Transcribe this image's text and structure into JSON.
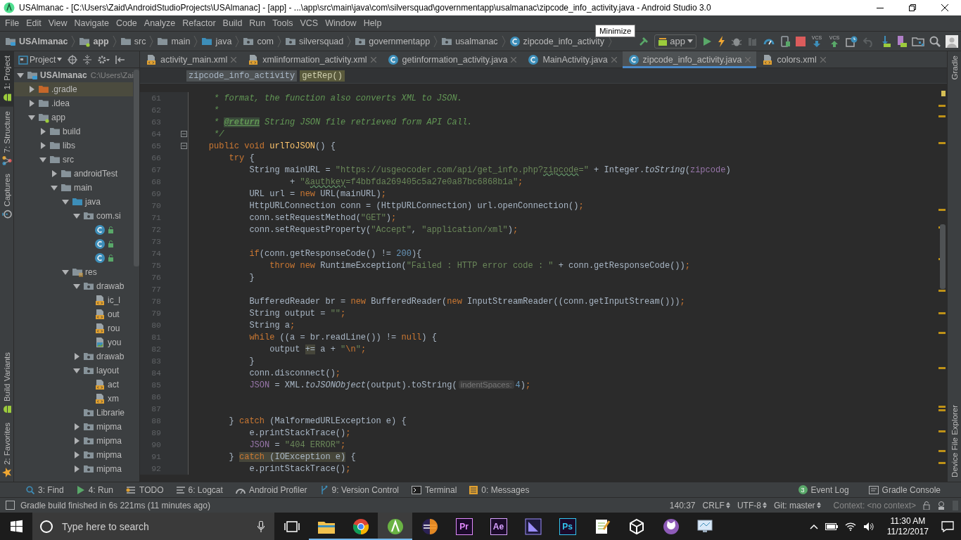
{
  "window": {
    "title": "USAlmanac - [C:\\Users\\Zaid\\AndroidStudioProjects\\USAlmanac] - [app] - ...\\app\\src\\main\\java\\com\\silversquad\\governmentapp\\usalmanac\\zipcode_info_activity.java - Android Studio 3.0"
  },
  "menu": [
    "File",
    "Edit",
    "View",
    "Navigate",
    "Code",
    "Analyze",
    "Refactor",
    "Build",
    "Run",
    "Tools",
    "VCS",
    "Window",
    "Help"
  ],
  "navigation": {
    "breadcrumbs": [
      {
        "label": "USAlmanac",
        "kind": "project"
      },
      {
        "label": "app",
        "kind": "module"
      },
      {
        "label": "src",
        "kind": "folder"
      },
      {
        "label": "main",
        "kind": "folder"
      },
      {
        "label": "java",
        "kind": "source"
      },
      {
        "label": "com",
        "kind": "package"
      },
      {
        "label": "silversquad",
        "kind": "package"
      },
      {
        "label": "governmentapp",
        "kind": "package"
      },
      {
        "label": "usalmanac",
        "kind": "package"
      },
      {
        "label": "zipcode_info_activity",
        "kind": "class"
      }
    ],
    "run_configuration": "app",
    "vcs_update": "VCS",
    "vcs_commit": "VCS",
    "tooltip": "Minimize"
  },
  "left_tool_strip": {
    "top": [
      {
        "label": "1: Project",
        "kind": "android",
        "selected": true
      },
      {
        "label": "7: Structure",
        "kind": "structure",
        "selected": false
      },
      {
        "label": "Captures",
        "kind": "captures",
        "selected": false
      }
    ],
    "bottom": [
      {
        "label": "Build Variants",
        "kind": "android",
        "selected": false
      },
      {
        "label": "2: Favorites",
        "kind": "star",
        "selected": false
      }
    ]
  },
  "right_tool_strip": {
    "top": [
      {
        "label": "Gradle",
        "selected": false
      }
    ],
    "bottom": [
      {
        "label": "Device File Explorer",
        "selected": false
      }
    ]
  },
  "project_panel": {
    "title": "Project",
    "tree": [
      {
        "label": "USAlmanac",
        "path": "C:\\Users\\Zai",
        "kind": "project",
        "expanded": true,
        "selected": false,
        "children": [
          {
            "label": ".gradle",
            "kind": "excluded",
            "expanded": false,
            "selected": true
          },
          {
            "label": ".idea",
            "kind": "folder",
            "expanded": false,
            "selected": false
          },
          {
            "label": "app",
            "kind": "module",
            "expanded": true,
            "selected": false,
            "children": [
              {
                "label": "build",
                "kind": "folder",
                "expanded": false,
                "selected": false
              },
              {
                "label": "libs",
                "kind": "folder",
                "expanded": false,
                "selected": false
              },
              {
                "label": "src",
                "kind": "folder",
                "expanded": true,
                "selected": false,
                "children": [
                  {
                    "label": "androidTest",
                    "kind": "folder",
                    "expanded": false,
                    "selected": false
                  },
                  {
                    "label": "main",
                    "kind": "folder",
                    "expanded": true,
                    "selected": false,
                    "children": [
                      {
                        "label": "java",
                        "kind": "source",
                        "expanded": true,
                        "selected": false,
                        "children": [
                          {
                            "label": "com.si",
                            "kind": "package",
                            "expanded": true,
                            "selected": false,
                            "children": [
                              {
                                "kind": "class",
                                "selected": false
                              },
                              {
                                "kind": "class",
                                "selected": false
                              },
                              {
                                "kind": "class",
                                "selected": false
                              }
                            ]
                          }
                        ]
                      },
                      {
                        "label": "res",
                        "kind": "resources",
                        "expanded": true,
                        "selected": false,
                        "children": [
                          {
                            "label": "drawab",
                            "kind": "package",
                            "expanded": true,
                            "selected": false,
                            "children": [
                              {
                                "label": "ic_l",
                                "kind": "xml",
                                "selected": false
                              },
                              {
                                "label": "out",
                                "kind": "xml",
                                "selected": false
                              },
                              {
                                "label": "rou",
                                "kind": "xml",
                                "selected": false
                              },
                              {
                                "label": "you",
                                "kind": "image",
                                "selected": false
                              }
                            ]
                          },
                          {
                            "label": "drawab",
                            "kind": "package",
                            "expanded": false,
                            "selected": false
                          },
                          {
                            "label": "layout",
                            "kind": "package",
                            "expanded": true,
                            "selected": false,
                            "children": [
                              {
                                "label": "act",
                                "kind": "xml",
                                "selected": false
                              },
                              {
                                "label": "xm",
                                "kind": "xml",
                                "selected": false
                              }
                            ]
                          },
                          {
                            "label": "Librarie",
                            "kind": "package",
                            "selected": false
                          },
                          {
                            "label": "mipma",
                            "kind": "package",
                            "expanded": false,
                            "selected": false
                          },
                          {
                            "label": "mipma",
                            "kind": "package",
                            "expanded": false,
                            "selected": false
                          },
                          {
                            "label": "mipma",
                            "kind": "package",
                            "expanded": false,
                            "selected": false
                          },
                          {
                            "label": "mipma",
                            "kind": "package",
                            "expanded": false,
                            "selected": false
                          }
                        ]
                      }
                    ]
                  }
                ]
              }
            ]
          }
        ]
      }
    ]
  },
  "editor": {
    "tabs": [
      {
        "label": "activity_main.xml",
        "kind": "xml",
        "selected": false
      },
      {
        "label": "xmlinformation_activity.xml",
        "kind": "xml",
        "selected": false
      },
      {
        "label": "getinformation_activity.java",
        "kind": "class",
        "selected": false
      },
      {
        "label": "MainActivity.java",
        "kind": "class",
        "selected": false
      },
      {
        "label": "zipcode_info_activity.java",
        "kind": "class",
        "selected": true
      },
      {
        "label": "colors.xml",
        "kind": "xml",
        "selected": false
      }
    ],
    "breadcrumbs": [
      "zipcode_info_activity",
      "getRep()"
    ],
    "lines": [
      {
        "number": "61",
        "tokens": [
          {
            "kind": "cmt",
            "text": "     * format, the function also converts XML to JSON."
          }
        ]
      },
      {
        "number": "62",
        "tokens": [
          {
            "kind": "cmt",
            "text": "     *"
          }
        ]
      },
      {
        "number": "63",
        "tokens": [
          {
            "kind": "cmt",
            "text": "     * "
          },
          {
            "kind": "tag",
            "text": "@return"
          },
          {
            "kind": "cmt",
            "text": " String JSON file retrieved form API Call."
          }
        ]
      },
      {
        "number": "64",
        "fold": true,
        "tokens": [
          {
            "kind": "cmt",
            "text": "     */"
          }
        ]
      },
      {
        "number": "65",
        "fold": true,
        "tokens": [
          {
            "kind": "kw",
            "text": "    public void "
          },
          {
            "kind": "decl",
            "text": "urlToJSON"
          },
          {
            "kind": "plain",
            "text": "() {"
          }
        ]
      },
      {
        "number": "66",
        "tokens": [
          {
            "kind": "kw",
            "text": "        try"
          },
          {
            "kind": "plain",
            "text": " {"
          }
        ]
      },
      {
        "number": "67",
        "tokens": [
          {
            "kind": "plain",
            "text": "            String mainURL = "
          },
          {
            "kind": "str",
            "text": "\"https://usgeocoder.com/api/get_info.php?"
          },
          {
            "kind": "typo",
            "text": "zipcode"
          },
          {
            "kind": "str",
            "text": "=\""
          },
          {
            "kind": "plain",
            "text": " + Integer."
          },
          {
            "kind": "static",
            "text": "toString"
          },
          {
            "kind": "plain",
            "text": "("
          },
          {
            "kind": "field",
            "text": "zipcode"
          },
          {
            "kind": "plain",
            "text": ")"
          }
        ]
      },
      {
        "number": "68",
        "tokens": [
          {
            "kind": "plain",
            "text": "                    + "
          },
          {
            "kind": "str",
            "text": "\"&"
          },
          {
            "kind": "typo",
            "text": "authkey"
          },
          {
            "kind": "str",
            "text": "=f4bbfda269405c5a27e0a87bc6868b1a\""
          },
          {
            "kind": "kw",
            "text": ";"
          }
        ]
      },
      {
        "number": "69",
        "tokens": [
          {
            "kind": "plain",
            "text": "            URL url = "
          },
          {
            "kind": "kw",
            "text": "new"
          },
          {
            "kind": "plain",
            "text": " URL(mainURL)"
          },
          {
            "kind": "kw",
            "text": ";"
          }
        ]
      },
      {
        "number": "70",
        "tokens": [
          {
            "kind": "plain",
            "text": "            HttpURLConnection conn = (HttpURLConnection) url.openConnection()"
          },
          {
            "kind": "kw",
            "text": ";"
          }
        ]
      },
      {
        "number": "71",
        "tokens": [
          {
            "kind": "plain",
            "text": "            conn.setRequestMethod("
          },
          {
            "kind": "str",
            "text": "\"GET\""
          },
          {
            "kind": "plain",
            "text": ")"
          },
          {
            "kind": "kw",
            "text": ";"
          }
        ]
      },
      {
        "number": "72",
        "tokens": [
          {
            "kind": "plain",
            "text": "            conn.setRequestProperty("
          },
          {
            "kind": "str",
            "text": "\"Accept\""
          },
          {
            "kind": "plain",
            "text": ", "
          },
          {
            "kind": "str",
            "text": "\"application/xml\""
          },
          {
            "kind": "plain",
            "text": ")"
          },
          {
            "kind": "kw",
            "text": ";"
          }
        ]
      },
      {
        "number": "73"
      },
      {
        "number": "74",
        "tokens": [
          {
            "kind": "kw",
            "text": "            if"
          },
          {
            "kind": "plain",
            "text": "(conn.getResponseCode() != "
          },
          {
            "kind": "num",
            "text": "200"
          },
          {
            "kind": "plain",
            "text": "){"
          }
        ]
      },
      {
        "number": "75",
        "tokens": [
          {
            "kind": "kw",
            "text": "                throw new"
          },
          {
            "kind": "plain",
            "text": " RuntimeException("
          },
          {
            "kind": "str",
            "text": "\"Failed : HTTP error code : \""
          },
          {
            "kind": "plain",
            "text": " + conn.getResponseCode())"
          },
          {
            "kind": "kw",
            "text": ";"
          }
        ]
      },
      {
        "number": "76",
        "tokens": [
          {
            "kind": "plain",
            "text": "            }"
          }
        ]
      },
      {
        "number": "77"
      },
      {
        "number": "78",
        "tokens": [
          {
            "kind": "plain",
            "text": "            BufferedReader br = "
          },
          {
            "kind": "kw",
            "text": "new"
          },
          {
            "kind": "plain",
            "text": " BufferedReader("
          },
          {
            "kind": "kw",
            "text": "new"
          },
          {
            "kind": "plain",
            "text": " InputStreamReader((conn.getInputStream()))"
          },
          {
            "kind": "kw",
            "text": ";"
          }
        ]
      },
      {
        "number": "79",
        "tokens": [
          {
            "kind": "plain",
            "text": "            String output = "
          },
          {
            "kind": "str",
            "text": "\"\""
          },
          {
            "kind": "kw",
            "text": ";"
          }
        ]
      },
      {
        "number": "80",
        "tokens": [
          {
            "kind": "plain",
            "text": "            String a"
          },
          {
            "kind": "kw",
            "text": ";"
          }
        ]
      },
      {
        "number": "81",
        "tokens": [
          {
            "kind": "kw",
            "text": "            while"
          },
          {
            "kind": "plain",
            "text": " ((a = br.readLine()) != "
          },
          {
            "kind": "kw",
            "text": "null"
          },
          {
            "kind": "plain",
            "text": ") {"
          }
        ]
      },
      {
        "number": "82",
        "tokens": [
          {
            "kind": "plain",
            "text": "                output "
          },
          {
            "kind": "match",
            "text": "+="
          },
          {
            "kind": "plain",
            "text": " a + "
          },
          {
            "kind": "str",
            "text": "\""
          },
          {
            "kind": "esc",
            "text": "\\n"
          },
          {
            "kind": "str",
            "text": "\""
          },
          {
            "kind": "kw",
            "text": ";"
          }
        ]
      },
      {
        "number": "83",
        "tokens": [
          {
            "kind": "plain",
            "text": "            }"
          }
        ]
      },
      {
        "number": "84",
        "tokens": [
          {
            "kind": "plain",
            "text": "            conn.disconnect()"
          },
          {
            "kind": "kw",
            "text": ";"
          }
        ]
      },
      {
        "number": "85",
        "tokens": [
          {
            "kind": "field",
            "text": "            JSON"
          },
          {
            "kind": "plain",
            "text": " = XML."
          },
          {
            "kind": "static",
            "text": "toJSONObject"
          },
          {
            "kind": "plain",
            "text": "(output).toString("
          },
          {
            "kind": "hint",
            "text": "indentSpaces:"
          },
          {
            "kind": "num",
            "text": "4"
          },
          {
            "kind": "plain",
            "text": ")"
          },
          {
            "kind": "kw",
            "text": ";"
          }
        ]
      },
      {
        "number": "86"
      },
      {
        "number": "87"
      },
      {
        "number": "88",
        "tokens": [
          {
            "kind": "plain",
            "text": "        } "
          },
          {
            "kind": "kw",
            "text": "catch"
          },
          {
            "kind": "plain",
            "text": " (MalformedURLException e) {"
          }
        ]
      },
      {
        "number": "89",
        "tokens": [
          {
            "kind": "plain",
            "text": "            e.printStackTrace()"
          },
          {
            "kind": "kw",
            "text": ";"
          }
        ]
      },
      {
        "number": "90",
        "tokens": [
          {
            "kind": "field",
            "text": "            JSON"
          },
          {
            "kind": "plain",
            "text": " = "
          },
          {
            "kind": "str",
            "text": "\"404 ERROR\""
          },
          {
            "kind": "kw",
            "text": ";"
          }
        ]
      },
      {
        "number": "91",
        "tokens": [
          {
            "kind": "plain",
            "text": "        } "
          },
          {
            "kind": "kwmatch",
            "text": "catch"
          },
          {
            "kind": "match",
            "text": " (IOException e)"
          },
          {
            "kind": "plain",
            "text": " {"
          }
        ]
      },
      {
        "number": "92",
        "tokens": [
          {
            "kind": "plain",
            "text": "            e.printStackTrace()"
          },
          {
            "kind": "kw",
            "text": ";"
          }
        ]
      }
    ]
  },
  "tool_windows": {
    "left": [
      {
        "label": "3: Find",
        "kind": "find"
      },
      {
        "label": "4: Run",
        "kind": "run"
      },
      {
        "label": "TODO",
        "kind": "todo"
      },
      {
        "label": "6: Logcat",
        "kind": "logcat"
      },
      {
        "label": "Android Profiler",
        "kind": "profiler"
      },
      {
        "label": "9: Version Control",
        "kind": "vcs"
      },
      {
        "label": "Terminal",
        "kind": "terminal"
      },
      {
        "label": "0: Messages",
        "kind": "messages"
      }
    ],
    "right": [
      {
        "label": "Event Log",
        "badge": "3"
      },
      {
        "label": "Gradle Console",
        "kind": "console"
      }
    ]
  },
  "status_bar": {
    "message": "Gradle build finished in 6s 221ms (11 minutes ago)",
    "position": "140:37",
    "line_separator": "CRLF",
    "encoding": "UTF-8",
    "branch": "Git: master",
    "context": "Context: <no context>"
  },
  "taskbar": {
    "search_placeholder": "Type here to search",
    "apps": [
      {
        "kind": "explorer",
        "running": true,
        "selected": false
      },
      {
        "kind": "chrome",
        "running": true,
        "selected": false
      },
      {
        "kind": "android_studio",
        "running": true,
        "selected": true
      },
      {
        "kind": "eclipse",
        "running": false,
        "selected": false
      },
      {
        "kind": "badge",
        "label": "Pr",
        "color": "#e38bff",
        "running": false,
        "selected": false
      },
      {
        "kind": "badge",
        "label": "Ae",
        "color": "#d8a1ff",
        "running": false,
        "selected": false
      },
      {
        "kind": "vs",
        "running": false,
        "selected": false
      },
      {
        "kind": "badge",
        "label": "Ps",
        "color": "#31c5f0",
        "running": false,
        "selected": false
      },
      {
        "kind": "notepad",
        "running": false,
        "selected": false
      },
      {
        "kind": "unity",
        "running": false,
        "selected": false
      },
      {
        "kind": "github",
        "running": false,
        "selected": false
      },
      {
        "kind": "remote",
        "running": false,
        "selected": false
      }
    ],
    "time": "11:30 AM",
    "date": "11/12/2017"
  }
}
